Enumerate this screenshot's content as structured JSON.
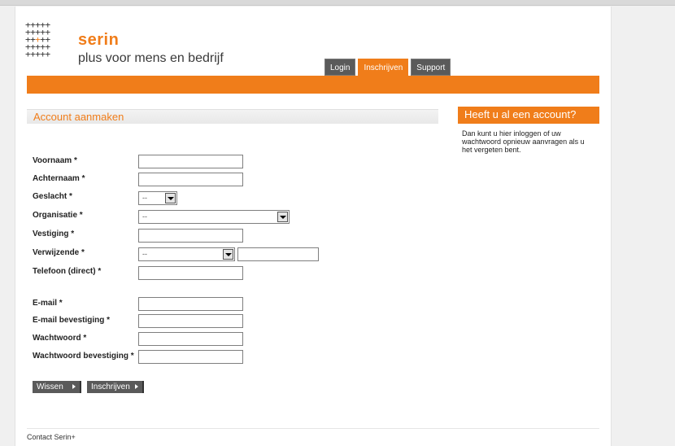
{
  "brand": {
    "name": "serin",
    "tagline": "plus voor mens en bedrijf",
    "accent_color": "#f07d1a"
  },
  "nav": {
    "tabs": [
      {
        "label": "Login",
        "active": false
      },
      {
        "label": "Inschrijven",
        "active": true
      },
      {
        "label": "Support",
        "active": false
      }
    ]
  },
  "form": {
    "title": "Account aanmaken",
    "fields": {
      "voornaam": {
        "label": "Voornaam *",
        "value": ""
      },
      "achternaam": {
        "label": "Achternaam *",
        "value": ""
      },
      "geslacht": {
        "label": "Geslacht *",
        "selected": "--"
      },
      "organisatie": {
        "label": "Organisatie *",
        "selected": "--"
      },
      "vestiging": {
        "label": "Vestiging *",
        "value": ""
      },
      "verwijzende": {
        "label": "Verwijzende *",
        "selected": "--",
        "extra_value": ""
      },
      "telefoon": {
        "label": "Telefoon (direct) *",
        "value": ""
      },
      "email": {
        "label": "E-mail *",
        "value": ""
      },
      "email_bevestiging": {
        "label": "E-mail bevestiging *",
        "value": ""
      },
      "wachtwoord": {
        "label": "Wachtwoord *",
        "value": ""
      },
      "wachtwoord_bevestiging": {
        "label": "Wachtwoord bevestiging *",
        "value": ""
      }
    },
    "buttons": {
      "clear": "Wissen",
      "submit": "Inschrijven"
    }
  },
  "sidebar": {
    "title": "Heeft u al een account?",
    "text": "Dan kunt u hier inloggen of uw wachtwoord opnieuw aanvragen als u het vergeten bent."
  },
  "footer": {
    "contact": "Contact Serin+"
  }
}
